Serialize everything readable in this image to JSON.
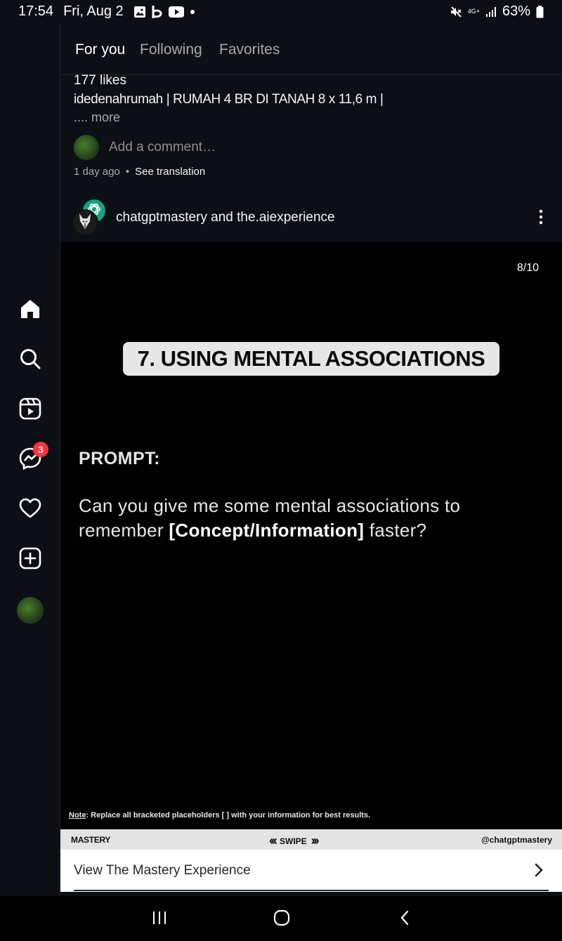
{
  "status": {
    "time": "17:54",
    "date": "Fri, Aug 2",
    "network_label": "4G+",
    "battery": "63%",
    "icons": [
      "gallery-icon",
      "b-app-icon",
      "youtube-icon",
      "mute-icon",
      "signal-icon",
      "battery-icon"
    ]
  },
  "sidebar": {
    "messages_badge": "3",
    "items": [
      "home-icon",
      "search-icon",
      "reels-icon",
      "messenger-icon",
      "heart-icon",
      "create-icon",
      "profile-avatar"
    ]
  },
  "tabs": [
    {
      "label": "For you",
      "active": true
    },
    {
      "label": "Following",
      "active": false
    },
    {
      "label": "Favorites",
      "active": false
    }
  ],
  "previous_post": {
    "likes": "177 likes",
    "caption": "idedenahrumah | RUMAH 4 BR DI TANAH 8 x 11,6 m |",
    "more": ".... more",
    "comment_placeholder": "Add a comment…",
    "time": "1 day ago",
    "separator": "•",
    "translate": "See translation"
  },
  "post": {
    "authors": "chatgptmastery and the.aiexperience",
    "counter": "8/10",
    "title": "7. USING MENTAL ASSOCIATIONS",
    "prompt_label": "PROMPT:",
    "prompt_text_a": "Can you give me some mental associations to remember ",
    "prompt_text_bold": "[Concept/Information]",
    "prompt_text_b": " faster?",
    "note_label": "Note",
    "note_text": ": Replace all bracketed placeholders [ ] with your information for best results.",
    "banner_brand": "MASTERY",
    "banner_swipe": "SWIPE",
    "banner_handle": "@chatgptmastery",
    "cta": "View The Mastery Experience"
  },
  "colors": {
    "background": "#0c1014",
    "badge": "#ff3040",
    "title_pill": "#e6e6e6",
    "banner": "#e3e3e3"
  }
}
